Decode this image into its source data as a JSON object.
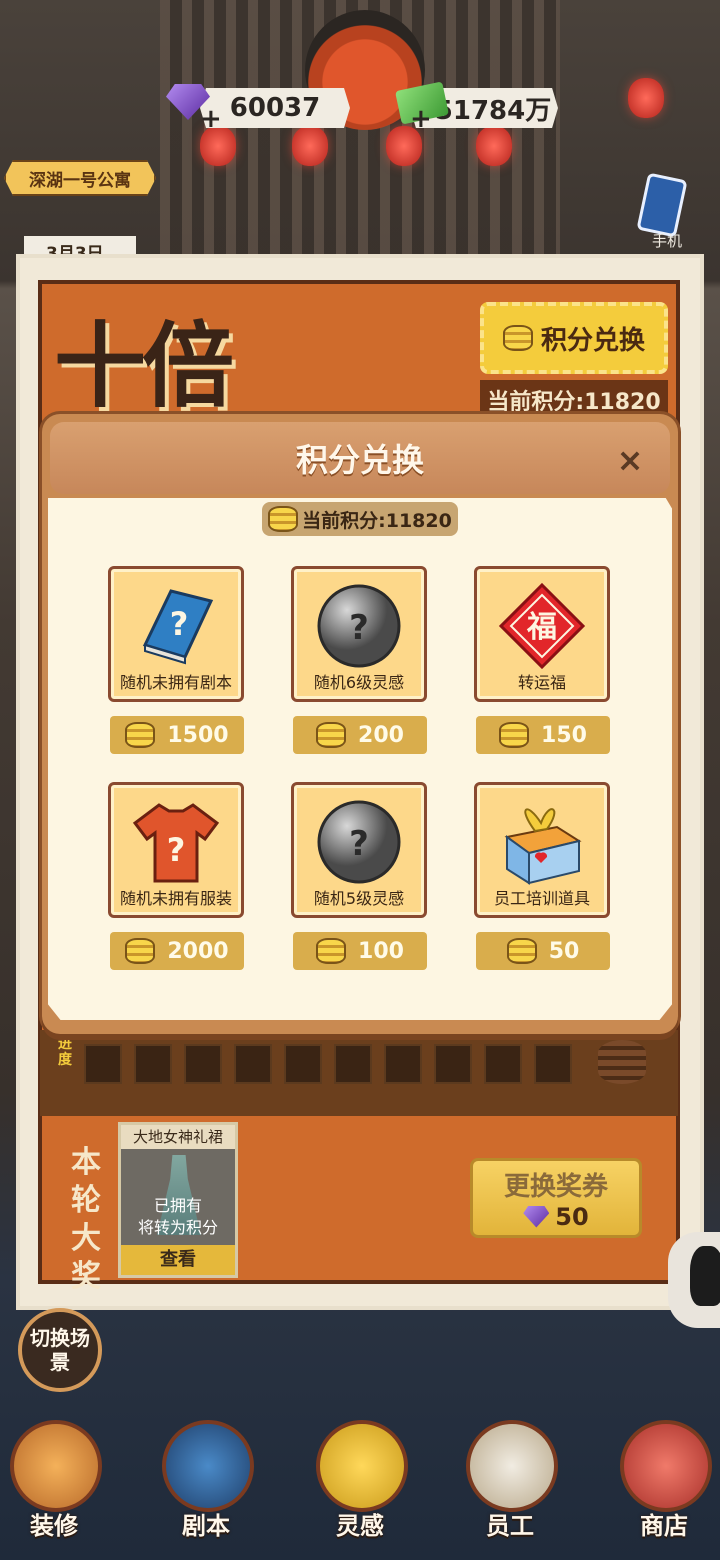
{
  "hud": {
    "gems": "60037",
    "cash": "51784万",
    "location": "深湖一号公寓",
    "date": "3月3日",
    "phone_label": "手机"
  },
  "event": {
    "title": "十倍",
    "exchange_button": "积分兑换",
    "current_points": "当前积分:11820",
    "progress_label": "进度",
    "grand_prize_label": "本轮大奖",
    "prize": {
      "name": "大地女神礼裙",
      "owned_line1": "已拥有",
      "owned_line2": "将转为积分",
      "view_button": "查看"
    },
    "swap_ticket": {
      "title": "更换奖券",
      "cost": "50"
    }
  },
  "modal": {
    "title": "积分兑换",
    "close": "×",
    "points": "当前积分:11820",
    "items": [
      {
        "label": "随机未拥有剧本",
        "price": "1500",
        "icon": "mystery-book-icon"
      },
      {
        "label": "随机6级灵感",
        "price": "200",
        "icon": "mystery-orb-icon"
      },
      {
        "label": "转运福",
        "price": "150",
        "icon": "fu-charm-icon"
      },
      {
        "label": "随机未拥有服装",
        "price": "2000",
        "icon": "mystery-shirt-icon"
      },
      {
        "label": "随机5级灵感",
        "price": "100",
        "icon": "mystery-orb-icon"
      },
      {
        "label": "员工培训道具",
        "price": "50",
        "icon": "gift-box-icon"
      }
    ]
  },
  "nav": {
    "switch_scene": "切换场景",
    "items": [
      "装修",
      "剧本",
      "灵感",
      "员工",
      "商店"
    ]
  },
  "colors": {
    "modal_bg": "#fdf6e2",
    "item_bg": "#fdd88a",
    "price_bg": "#d9ad4c",
    "event_orange": "#cf6b2c"
  }
}
